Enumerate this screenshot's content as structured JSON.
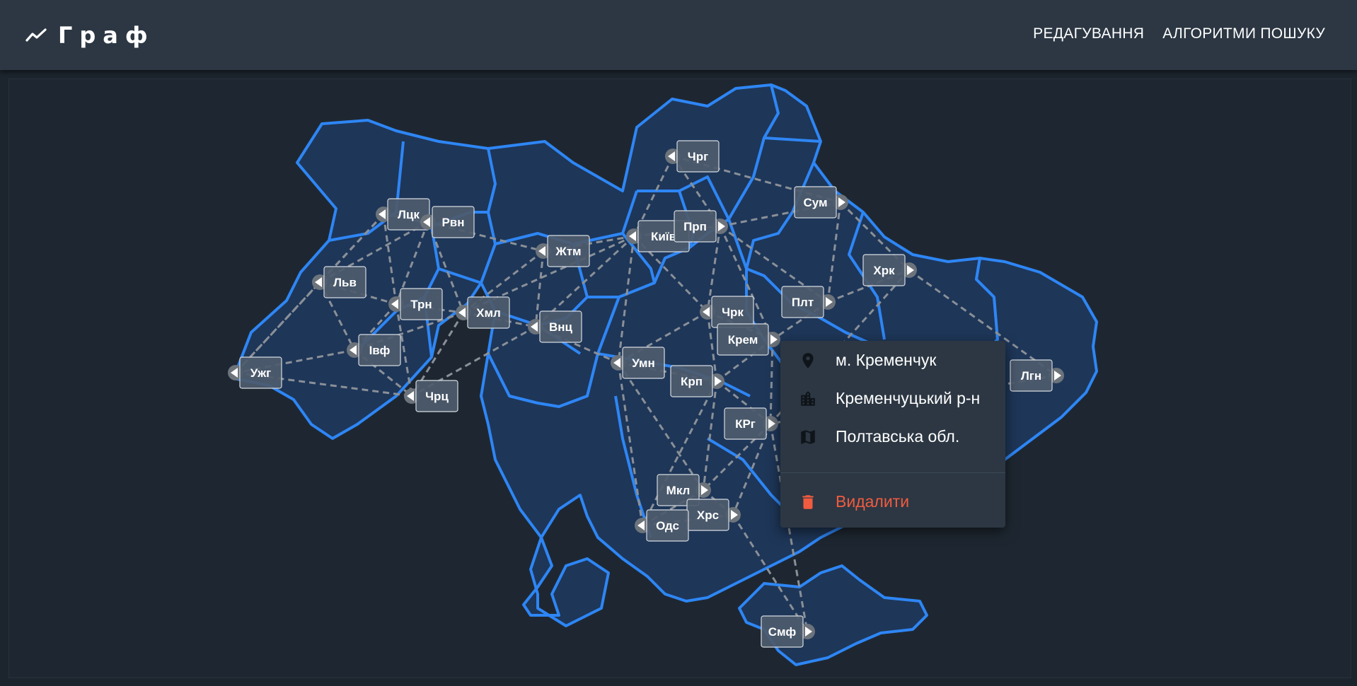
{
  "app": {
    "title": "Граф"
  },
  "nav": {
    "edit": "РЕДАГУВАННЯ",
    "search_algorithms": "АЛГОРИТМИ ПОШУКУ"
  },
  "colors": {
    "appbar": "#2c3743",
    "background": "#1c242d",
    "region_fill": "#1e3658",
    "border": "#2e86f5",
    "edge": "#8a9098",
    "node": "#6c737b",
    "danger": "#f25b3f"
  },
  "nodes": [
    {
      "id": "chrg",
      "label": "Чрг"
    },
    {
      "id": "sum",
      "label": "Сум"
    },
    {
      "id": "lck",
      "label": "Лцк"
    },
    {
      "id": "rvn",
      "label": "Рвн"
    },
    {
      "id": "kyiv",
      "label": "Київ"
    },
    {
      "id": "prp",
      "label": "Прп"
    },
    {
      "id": "zhtm",
      "label": "Жтм"
    },
    {
      "id": "lvv",
      "label": "Льв"
    },
    {
      "id": "trn",
      "label": "Трн"
    },
    {
      "id": "khml",
      "label": "Хмл"
    },
    {
      "id": "vnc",
      "label": "Внц"
    },
    {
      "id": "chrk",
      "label": "Чрк"
    },
    {
      "id": "plt",
      "label": "Плт"
    },
    {
      "id": "khrk",
      "label": "Хрк"
    },
    {
      "id": "ivf",
      "label": "Івф"
    },
    {
      "id": "krem",
      "label": "Крем"
    },
    {
      "id": "uzhg",
      "label": "Ужг"
    },
    {
      "id": "umn",
      "label": "Умн"
    },
    {
      "id": "krp",
      "label": "Крп"
    },
    {
      "id": "lgn",
      "label": "Лгн"
    },
    {
      "id": "chrc",
      "label": "Чрц"
    },
    {
      "id": "krg",
      "label": "КРг"
    },
    {
      "id": "mkl",
      "label": "Мкл"
    },
    {
      "id": "khrs",
      "label": "Хрс"
    },
    {
      "id": "ods",
      "label": "Одс"
    },
    {
      "id": "smf",
      "label": "Смф"
    }
  ],
  "edges": [
    [
      "chrg",
      "kyiv"
    ],
    [
      "chrg",
      "prp"
    ],
    [
      "chrg",
      "sum"
    ],
    [
      "sum",
      "prp"
    ],
    [
      "sum",
      "khrk"
    ],
    [
      "sum",
      "plt"
    ],
    [
      "lck",
      "rvn"
    ],
    [
      "lck",
      "lvv"
    ],
    [
      "lck",
      "trn"
    ],
    [
      "lck",
      "uzhg"
    ],
    [
      "rvn",
      "zhtm"
    ],
    [
      "rvn",
      "lvv"
    ],
    [
      "rvn",
      "trn"
    ],
    [
      "rvn",
      "khml"
    ],
    [
      "kyiv",
      "prp"
    ],
    [
      "kyiv",
      "zhtm"
    ],
    [
      "kyiv",
      "chrk"
    ],
    [
      "kyiv",
      "umn"
    ],
    [
      "kyiv",
      "vnc"
    ],
    [
      "kyiv",
      "khml"
    ],
    [
      "prp",
      "plt"
    ],
    [
      "prp",
      "chrk"
    ],
    [
      "prp",
      "krem"
    ],
    [
      "zhtm",
      "khml"
    ],
    [
      "zhtm",
      "vnc"
    ],
    [
      "lvv",
      "trn"
    ],
    [
      "lvv",
      "ivf"
    ],
    [
      "lvv",
      "uzhg"
    ],
    [
      "trn",
      "khml"
    ],
    [
      "trn",
      "ivf"
    ],
    [
      "trn",
      "chrc"
    ],
    [
      "khml",
      "vnc"
    ],
    [
      "khml",
      "chrc"
    ],
    [
      "khml",
      "ivf"
    ],
    [
      "vnc",
      "umn"
    ],
    [
      "vnc",
      "chrc"
    ],
    [
      "chrk",
      "krem"
    ],
    [
      "chrk",
      "umn"
    ],
    [
      "chrk",
      "krp"
    ],
    [
      "plt",
      "krem"
    ],
    [
      "plt",
      "khrk"
    ],
    [
      "khrk",
      "lgn"
    ],
    [
      "khrk",
      "krg"
    ],
    [
      "ivf",
      "uzhg"
    ],
    [
      "ivf",
      "chrc"
    ],
    [
      "uzhg",
      "chrc"
    ],
    [
      "krem",
      "krp"
    ],
    [
      "krem",
      "krg"
    ],
    [
      "umn",
      "krp"
    ],
    [
      "umn",
      "ods"
    ],
    [
      "umn",
      "mkl"
    ],
    [
      "krp",
      "krg"
    ],
    [
      "krp",
      "mkl"
    ],
    [
      "krp",
      "ods"
    ],
    [
      "krg",
      "mkl"
    ],
    [
      "krg",
      "khrs"
    ],
    [
      "mkl",
      "khrs"
    ],
    [
      "mkl",
      "ods"
    ],
    [
      "ods",
      "khrs"
    ],
    [
      "khrs",
      "smf"
    ],
    [
      "krg",
      "smf"
    ],
    [
      "lgn",
      "krg"
    ]
  ],
  "context_menu": {
    "city": "м. Кременчук",
    "district": "Кременчуцький р-н",
    "oblast": "Полтавська обл.",
    "delete": "Видалити",
    "icons": [
      "map-marker-icon",
      "city-icon",
      "map-icon",
      "trash-icon"
    ]
  }
}
